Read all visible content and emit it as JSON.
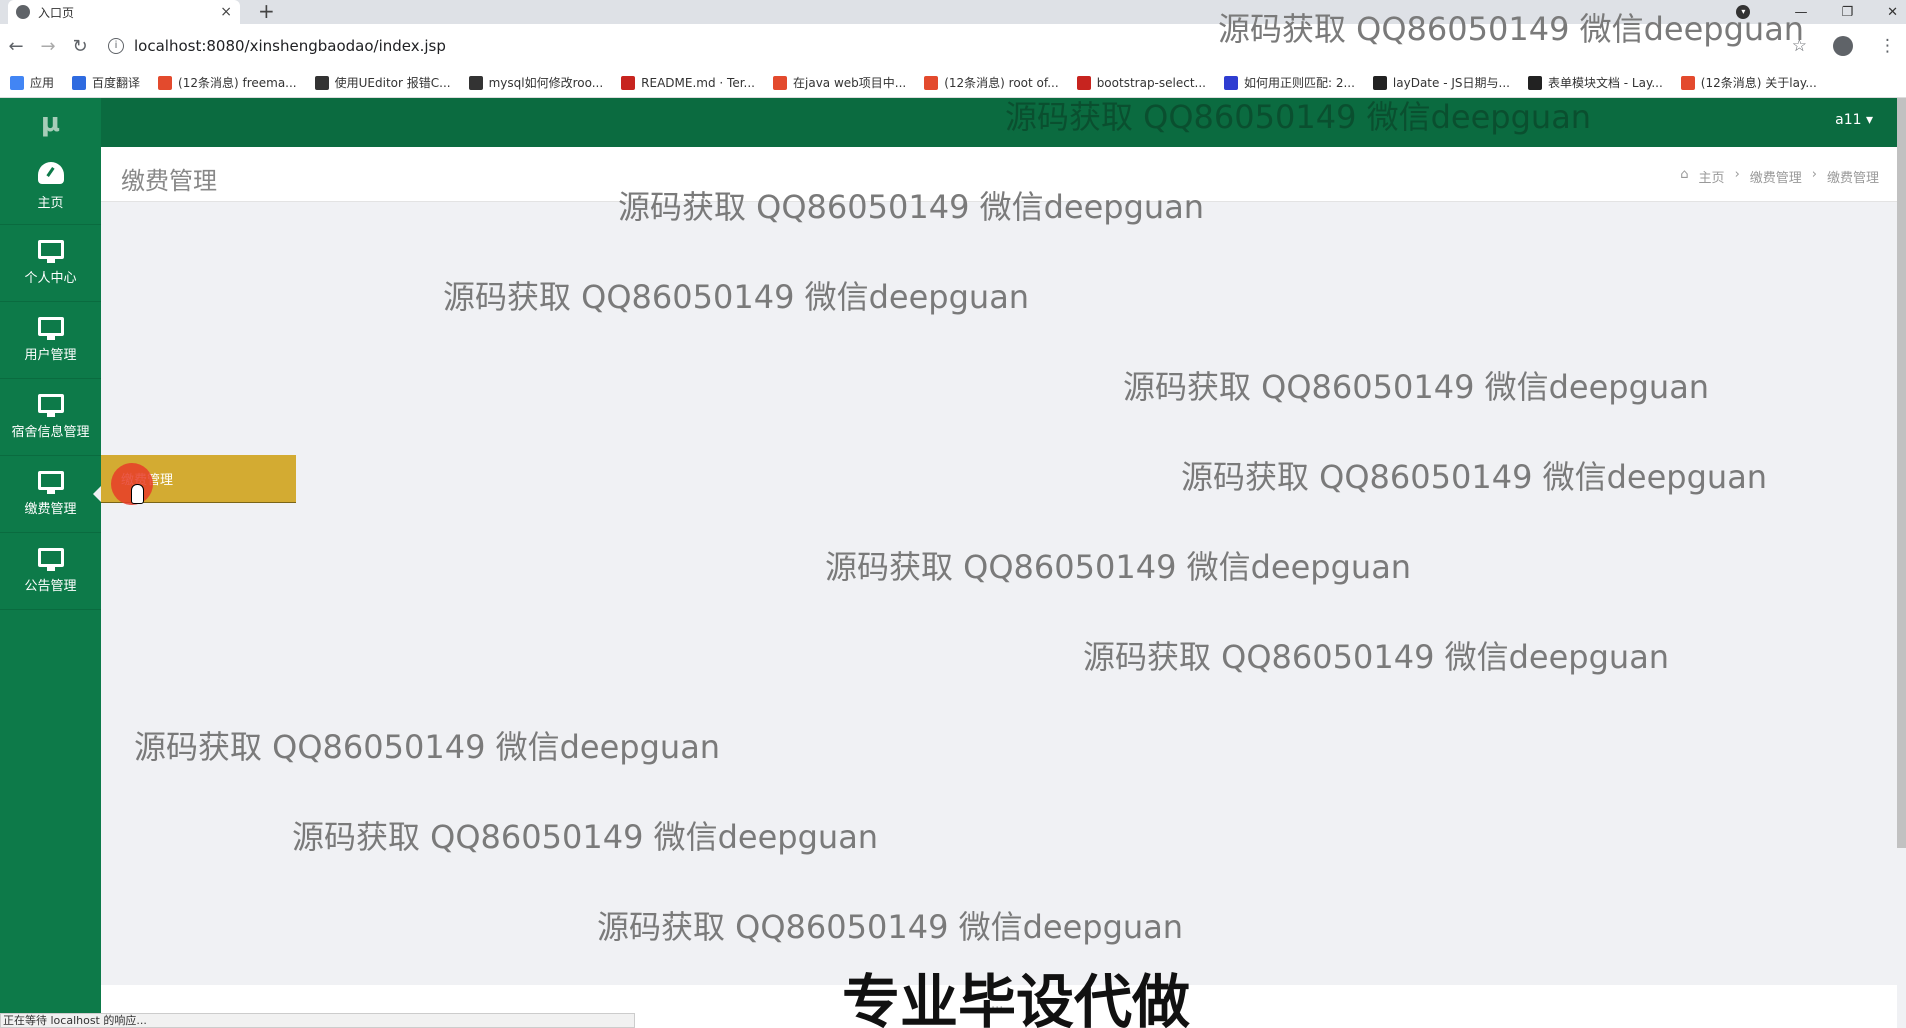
{
  "browser": {
    "tab_title": "入口页",
    "tab_close": "×",
    "new_tab": "+",
    "url": "localhost:8080/xinshengbaodao/index.jsp",
    "bookmarks": [
      {
        "label": "应用",
        "color": "#4285f4"
      },
      {
        "label": "百度翻译",
        "color": "#2f6be0"
      },
      {
        "label": "(12条消息) freema...",
        "color": "#e34a2d"
      },
      {
        "label": "使用UEditor 报错C...",
        "color": "#333333"
      },
      {
        "label": "mysql如何修改roo...",
        "color": "#333333"
      },
      {
        "label": "README.md · Ter...",
        "color": "#c7241f"
      },
      {
        "label": "在java web项目中...",
        "color": "#e34a2d"
      },
      {
        "label": "(12条消息) root of...",
        "color": "#e34a2d"
      },
      {
        "label": "bootstrap-select...",
        "color": "#c7241f"
      },
      {
        "label": "如何用正则匹配: 2...",
        "color": "#2f3dd1"
      },
      {
        "label": "layDate - JS日期与...",
        "color": "#222222"
      },
      {
        "label": "表单模块文档 - Lay...",
        "color": "#222222"
      },
      {
        "label": "(12条消息) 关于lay...",
        "color": "#e34a2d"
      }
    ],
    "status_text": "正在等待 localhost 的响应..."
  },
  "sidebar": {
    "logo": "μ",
    "items": [
      {
        "label": "主页",
        "icon": "dashboard-icon"
      },
      {
        "label": "个人中心",
        "icon": "monitor-icon"
      },
      {
        "label": "用户管理",
        "icon": "monitor-icon"
      },
      {
        "label": "宿舍信息管理",
        "icon": "monitor-icon"
      },
      {
        "label": "缴费管理",
        "icon": "monitor-icon"
      },
      {
        "label": "公告管理",
        "icon": "monitor-icon"
      }
    ],
    "flyout_label": "缴费管理"
  },
  "topnav": {
    "user": "a11 ▾"
  },
  "content": {
    "title": "缴费管理",
    "breadcrumb": [
      "主页",
      "›",
      "缴费管理",
      "›",
      "缴费管理"
    ]
  },
  "watermark_text": "源码获取 QQ86050149 微信deepguan",
  "banner_text": "专业毕设代做",
  "footer_text": "..."
}
